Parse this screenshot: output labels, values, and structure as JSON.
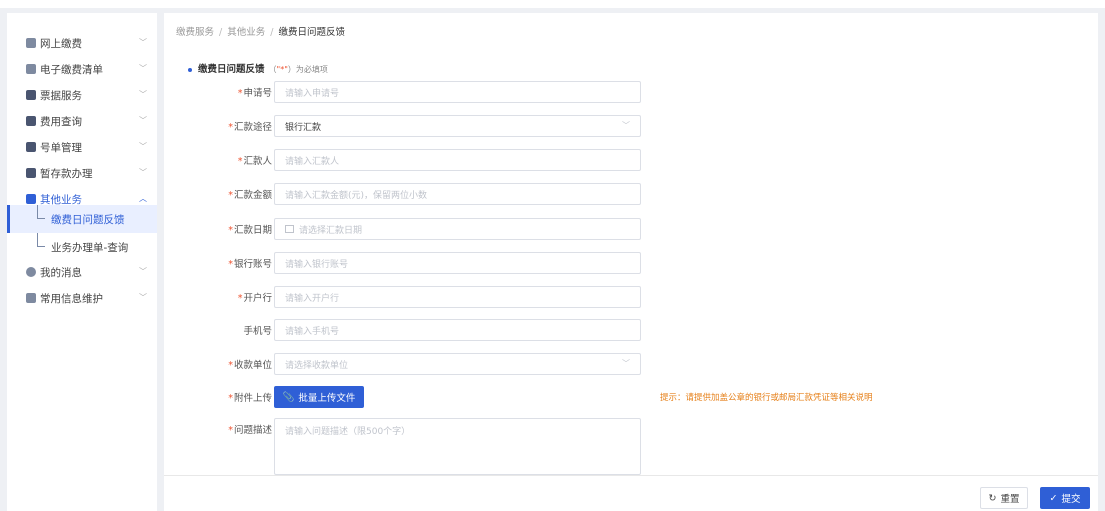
{
  "sidebar": {
    "items": [
      {
        "label": "网上缴费",
        "icon": "wallet-icon",
        "color": "#7e8aa0"
      },
      {
        "label": "电子缴费清单",
        "icon": "list-icon",
        "color": "#7e8aa0"
      },
      {
        "label": "票据服务",
        "icon": "receipt-icon",
        "color": "#4a5570"
      },
      {
        "label": "费用查询",
        "icon": "query-icon",
        "color": "#4a5570"
      },
      {
        "label": "号单管理",
        "icon": "doc-icon",
        "color": "#4a5570"
      },
      {
        "label": "暂存款办理",
        "icon": "deposit-icon",
        "color": "#4a5570"
      },
      {
        "label": "其他业务",
        "icon": "business-icon",
        "color": "#2f5fd6"
      },
      {
        "label": "我的消息",
        "icon": "message-icon",
        "color": "#7e8aa0"
      },
      {
        "label": "常用信息维护",
        "icon": "edit-icon",
        "color": "#7e8aa0"
      }
    ],
    "subitems": [
      {
        "label": "缴费日问题反馈"
      },
      {
        "label": "业务办理单-查询"
      }
    ],
    "chevron_down": "﹀",
    "chevron_up": "︿"
  },
  "breadcrumb": {
    "items": [
      "缴费服务",
      "其他业务",
      "缴费日问题反馈"
    ],
    "separator": "/"
  },
  "form": {
    "title": "缴费日问题反馈",
    "note_open": "（",
    "note_star": "\"*\"",
    "note_rest": "）为必填项",
    "required_mark": "*",
    "fields": [
      {
        "label": "申请号",
        "placeholder": "请输入申请号",
        "required": true
      },
      {
        "label": "汇款途径",
        "value": "银行汇款",
        "required": true
      },
      {
        "label": "汇款人",
        "placeholder": "请输入汇款人",
        "required": true
      },
      {
        "label": "汇款金额",
        "placeholder": "请输入汇款金额(元)，保留两位小数",
        "required": true
      },
      {
        "label": "汇款日期",
        "placeholder": "请选择汇款日期",
        "required": true
      },
      {
        "label": "银行账号",
        "placeholder": "请输入银行账号",
        "required": true
      },
      {
        "label": "开户行",
        "placeholder": "请输入开户行",
        "required": true
      },
      {
        "label": "手机号",
        "placeholder": "请输入手机号",
        "required": false
      },
      {
        "label": "收款单位",
        "placeholder": "请选择收款单位",
        "required": true
      },
      {
        "label": "附件上传",
        "required": true
      },
      {
        "label": "问题描述",
        "placeholder": "请输入问题描述（限500个字）",
        "required": true
      }
    ],
    "upload_button": "批量上传文件",
    "upload_tip": "提示：请提供加盖公章的银行或邮局汇款凭证等相关说明"
  },
  "footer": {
    "reset_label": "重置",
    "submit_label": "提交",
    "reset_icon": "↻",
    "submit_icon": "✓"
  },
  "colors": {
    "primary": "#2f5fd6",
    "warning": "#e6801a",
    "required": "#e53"
  }
}
